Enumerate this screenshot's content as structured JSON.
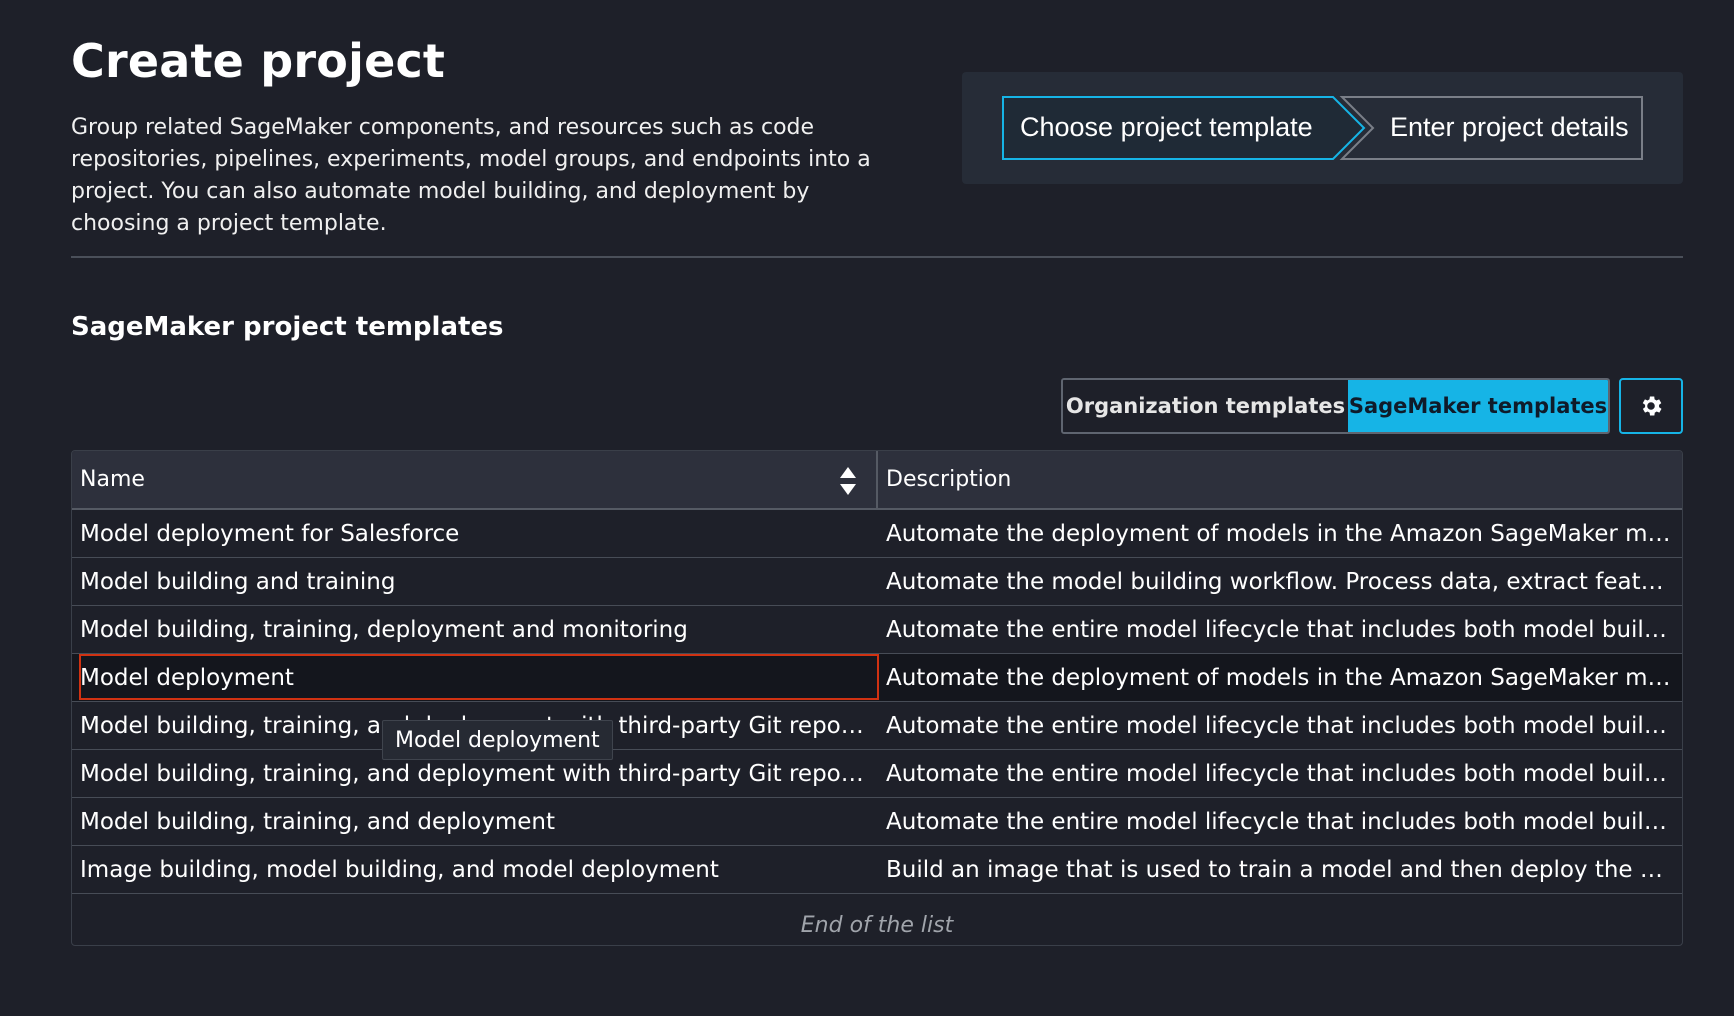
{
  "header": {
    "title": "Create project",
    "description": "Group related SageMaker components, and resources such as code repositories, pipelines, experiments, model groups, and endpoints into a project. You can also automate model building, and deployment by choosing a project template."
  },
  "wizard": {
    "steps": [
      {
        "label": "Choose project template",
        "active": true
      },
      {
        "label": "Enter project details",
        "active": false
      }
    ],
    "accent_color": "#16b4e6"
  },
  "section": {
    "title": "SageMaker project templates"
  },
  "segmented": {
    "options": [
      "Organization templates",
      "SageMaker templates"
    ],
    "selected": "SageMaker templates"
  },
  "settings": {
    "icon": "gear-icon"
  },
  "table": {
    "columns": [
      "Name",
      "Description"
    ],
    "rows": [
      {
        "name": "Model deployment for Salesforce",
        "description": "Automate the deployment of models in the Amazon SageMaker mod…"
      },
      {
        "name": "Model building and training",
        "description": "Automate the model building workflow. Process data, extract feature…"
      },
      {
        "name": "Model building, training, deployment and monitoring",
        "description": "Automate the entire model lifecycle that includes both model buildin…"
      },
      {
        "name": "Model deployment",
        "description": "Automate the deployment of models in the Amazon SageMaker mod…"
      },
      {
        "name": "Model building, training, and deployment with third-party Git reposit…",
        "description": "Automate the entire model lifecycle that includes both model buildin…"
      },
      {
        "name": "Model building, training, and deployment with third-party Git reposit…",
        "description": "Automate the entire model lifecycle that includes both model buildin…"
      },
      {
        "name": "Model building, training, and deployment",
        "description": "Automate the entire model lifecycle that includes both model buildin…"
      },
      {
        "name": "Image building, model building, and model deployment",
        "description": "Build an image that is used to train a model and then deploy the mod…"
      }
    ],
    "selected_row": 3,
    "end_text": "End of the list"
  },
  "tooltip": {
    "text": "Model deployment"
  }
}
